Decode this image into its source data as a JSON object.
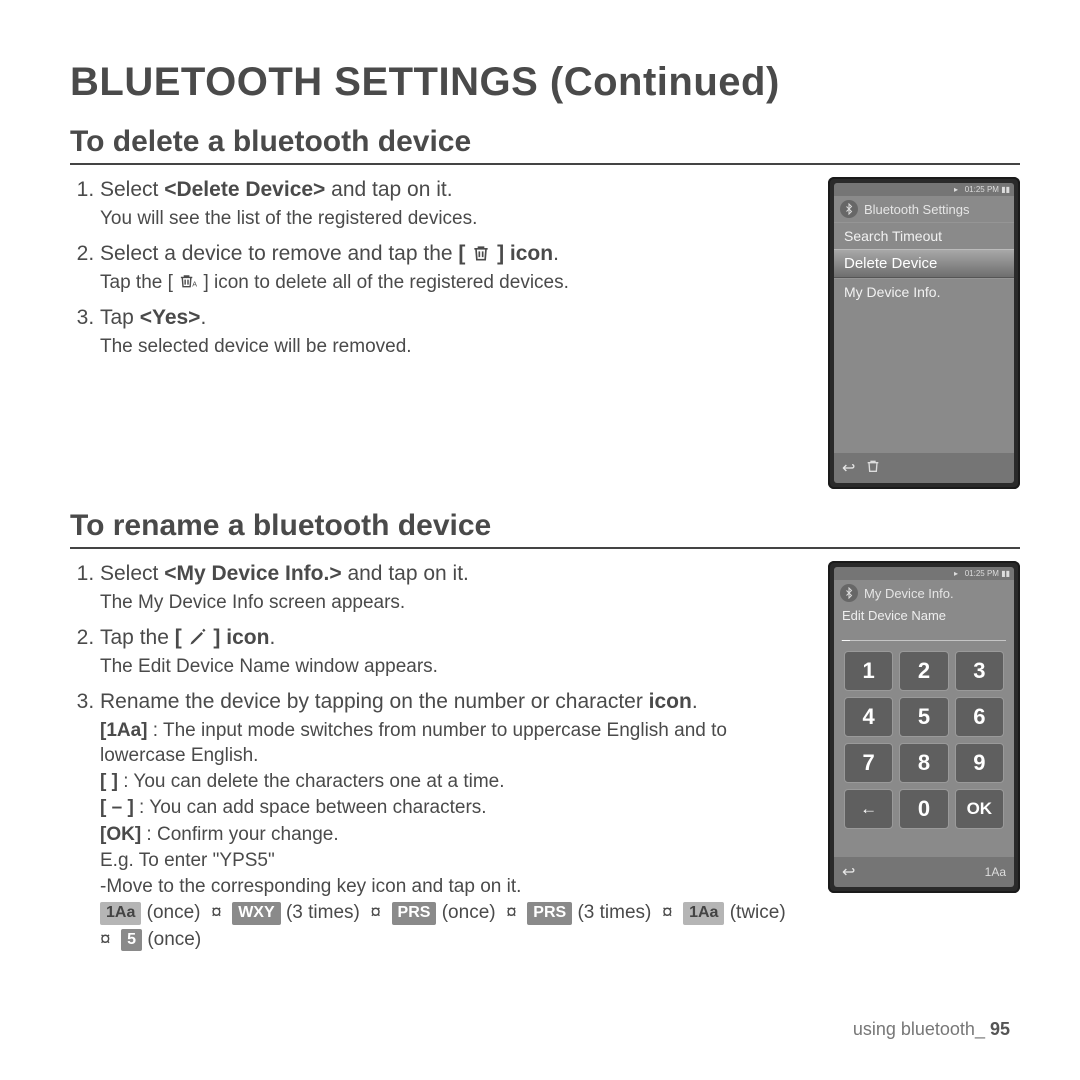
{
  "title": "BLUETOOTH SETTINGS (Continued)",
  "section1": {
    "heading": "To delete a bluetooth device",
    "step1_a": "Select ",
    "step1_bold": "<Delete Device>",
    "step1_b": " and tap on it.",
    "step1_sub": "You will see the list of the registered devices.",
    "step2_a": "Select a device to remove and tap the ",
    "step2_b": "[",
    "step2_c": "]",
    "step2_bold": "icon",
    "step2_sub_a": "Tap the [",
    "step2_sub_b": "] icon to delete all of the registered devices.",
    "step3_a": "Tap ",
    "step3_bold": "<Yes>",
    "step3_sub": "The selected device will be removed."
  },
  "device1": {
    "status": "01:25 PM",
    "header": "Bluetooth Settings",
    "items": [
      "Search Timeout",
      "Delete Device",
      "My Device Info."
    ]
  },
  "section2": {
    "heading": "To rename a bluetooth device",
    "step1_a": "Select ",
    "step1_bold": "<My Device Info.>",
    "step1_b": " and tap on it.",
    "step1_sub": "The My Device Info screen appears.",
    "step2_a": "Tap the ",
    "step2_b": "[",
    "step2_c": "]",
    "step2_bold": " icon",
    "step2_sub": "The Edit Device Name window appears.",
    "step3_a": "Rename the device by tapping on the number or character ",
    "step3_bold": "icon",
    "exp1_label": "[1Aa]",
    "exp1_text": " : The input mode switches from number to uppercase English and to lowercase English.",
    "exp2_label": "[      ]",
    "exp2_text": " : You can delete the characters one at a time.",
    "exp3_label": "[ – ]",
    "exp3_text": " : You can add space between characters.",
    "exp4_label": "[OK]",
    "exp4_text": " : Confirm your change.",
    "example_intro": "E.g. To enter \"YPS5\"",
    "example_move": "-Move to the corresponding key icon and tap on it.",
    "seq": {
      "k1": "1Aa",
      "t1": "(once)",
      "k2": "WXY",
      "t2": "(3 times)",
      "k3": "PRS",
      "t3": "(once)",
      "k4": "PRS",
      "t4": "(3 times)",
      "k5": "1Aa",
      "t5": "(twice)",
      "k6": "5",
      "t6": "(once)",
      "sep": "¤"
    }
  },
  "device2": {
    "status": "01:25 PM",
    "header": "My Device Info.",
    "edit_label": "Edit Device Name",
    "cursor": "_",
    "keys": [
      "1",
      "2",
      "3",
      "4",
      "5",
      "6",
      "7",
      "8",
      "9",
      "←",
      "0",
      "OK"
    ],
    "mode": "1Aa"
  },
  "footer": {
    "section": "using bluetooth",
    "sep": "_ ",
    "page": "95"
  }
}
